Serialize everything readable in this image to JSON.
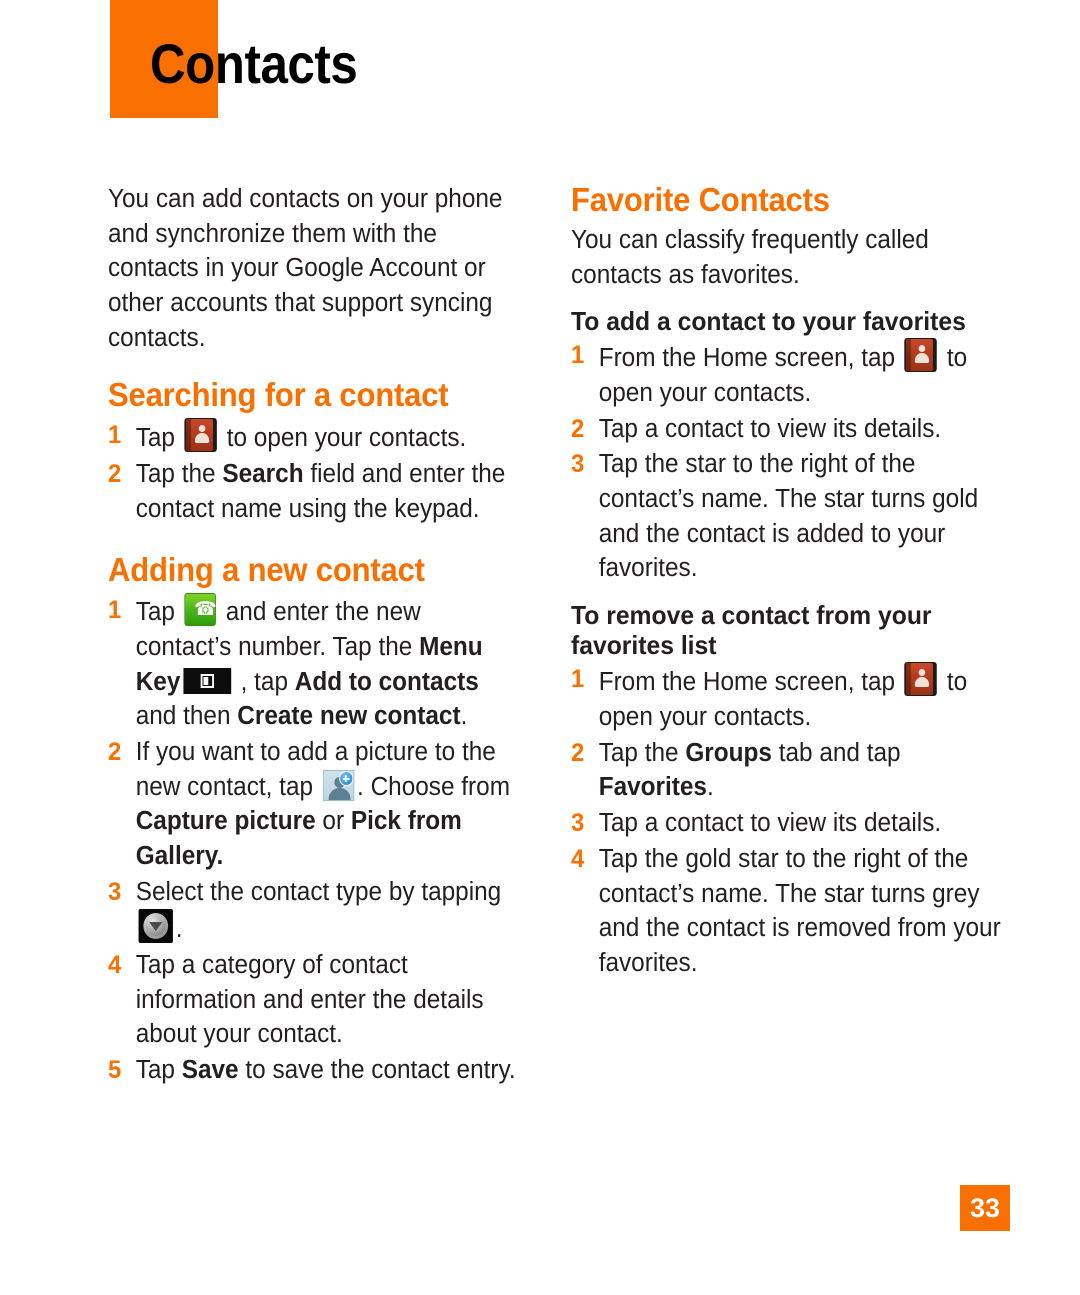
{
  "header": {
    "title": "Contacts"
  },
  "page": {
    "number": "33"
  },
  "left_column": {
    "intro": "You can add contacts on your phone and synchronize them with the contacts in your Google Account or other accounts that support syncing contacts.",
    "section_1": {
      "heading": "Searching for a contact",
      "steps": [
        {
          "num": "1",
          "pre": "Tap ",
          "icon": "contacts-book-icon",
          "post": " to open your contacts."
        },
        {
          "num": "2",
          "pre": "Tap the ",
          "bold": "Search",
          "post": " field and enter the contact name using the keypad."
        }
      ]
    },
    "section_2": {
      "heading": "Adding a new contact",
      "step1": {
        "num": "1",
        "a": "Tap ",
        "icon1": "phone-dial-icon",
        "b": " and enter the new contact’s number. Tap the ",
        "bold1": "Menu Key",
        "icon2": "menu-key-icon",
        "c": " , tap ",
        "bold2": "Add to contacts",
        "d": " and then ",
        "bold3": "Create new contact",
        "e": "."
      },
      "step2": {
        "num": "2",
        "a": "If you want to add a picture to the new contact, tap ",
        "icon": "add-photo-icon",
        "b": ". Choose from ",
        "bold1": "Capture picture",
        "c": " or ",
        "bold2": "Pick from Gallery."
      },
      "step3": {
        "num": "3",
        "a": "Select the contact type by tapping ",
        "icon": "dropdown-arrow-icon",
        "b": "."
      },
      "step4": {
        "num": "4",
        "text": "Tap a category of contact information and enter the details about your contact."
      },
      "step5": {
        "num": "5",
        "a": "Tap ",
        "bold": "Save",
        "b": " to save the contact entry."
      }
    }
  },
  "right_column": {
    "section": {
      "heading": "Favorite Contacts",
      "intro": "You can classify frequently called contacts as favorites."
    },
    "add_favorites": {
      "heading": "To add a contact to your favorites",
      "step1": {
        "num": "1",
        "a": "From the Home screen, tap ",
        "icon": "contacts-book-icon",
        "b": " to open your contacts."
      },
      "step2": {
        "num": "2",
        "text": "Tap a contact to view its details."
      },
      "step3": {
        "num": "3",
        "text": "Tap the star to the right of the contact’s name. The star turns gold and the contact is added to your favorites."
      }
    },
    "remove_favorites": {
      "heading": "To remove a contact from your favorites list",
      "step1": {
        "num": "1",
        "a": "From the Home screen, tap ",
        "icon": "contacts-book-icon",
        "b": " to open your contacts."
      },
      "step2": {
        "num": "2",
        "a": "Tap the ",
        "bold1": "Groups",
        "b": " tab and tap ",
        "bold2": "Favorites",
        "c": "."
      },
      "step3": {
        "num": "3",
        "text": "Tap a contact to view its details."
      },
      "step4": {
        "num": "4",
        "text": "Tap the gold star to the right of the contact’s name. The star turns grey and the contact is removed from your favorites."
      }
    }
  },
  "colors": {
    "accent_orange": "#FA7000",
    "text_black": "#231f20"
  }
}
